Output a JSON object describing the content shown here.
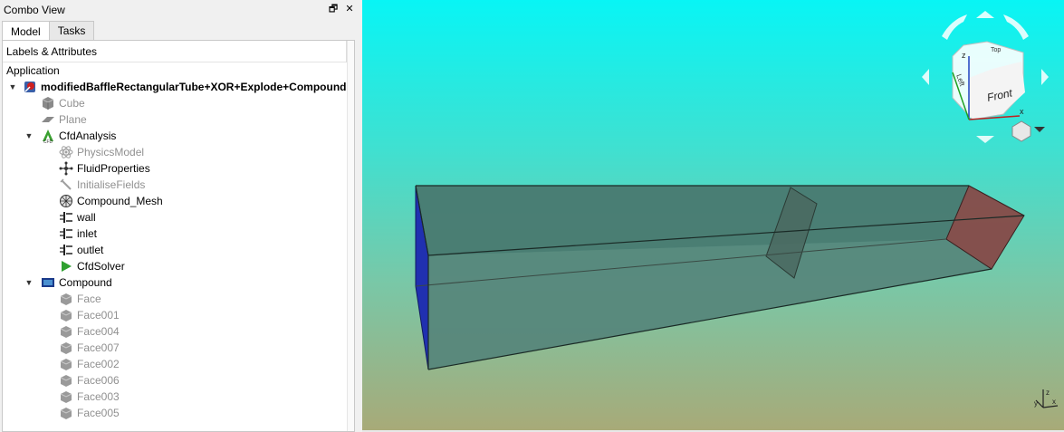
{
  "combo": {
    "title": "Combo View",
    "float_glyph": "🗗",
    "close_glyph": "✕",
    "tabs": [
      {
        "label": "Model",
        "active": true
      },
      {
        "label": "Tasks",
        "active": false
      }
    ],
    "tree_header": "Labels & Attributes"
  },
  "tree": {
    "application": "Application",
    "document": "modifiedBaffleRectangularTube+XOR+Explode+Compound",
    "cube": "Cube",
    "plane": "Plane",
    "cfd_analysis": "CfdAnalysis",
    "physics_model": "PhysicsModel",
    "fluid_properties": "FluidProperties",
    "initialise_fields": "InitialiseFields",
    "compound_mesh": "Compound_Mesh",
    "wall": "wall",
    "inlet": "inlet",
    "outlet": "outlet",
    "cfd_solver": "CfdSolver",
    "compound": "Compound",
    "faces": [
      "Face",
      "Face001",
      "Face004",
      "Face007",
      "Face002",
      "Face006",
      "Face003",
      "Face005"
    ]
  },
  "navcube": {
    "front": "Front",
    "left": "Left",
    "top": "Top",
    "axis_x": "x",
    "axis_y": "y",
    "axis_z": "z"
  },
  "colors": {
    "viewport_top": "#08f5f5",
    "viewport_bottom": "#a8aa78",
    "inlet_face": "#2030b0",
    "outlet_face": "#8a4a48",
    "tube_body": "#4a7a70"
  }
}
